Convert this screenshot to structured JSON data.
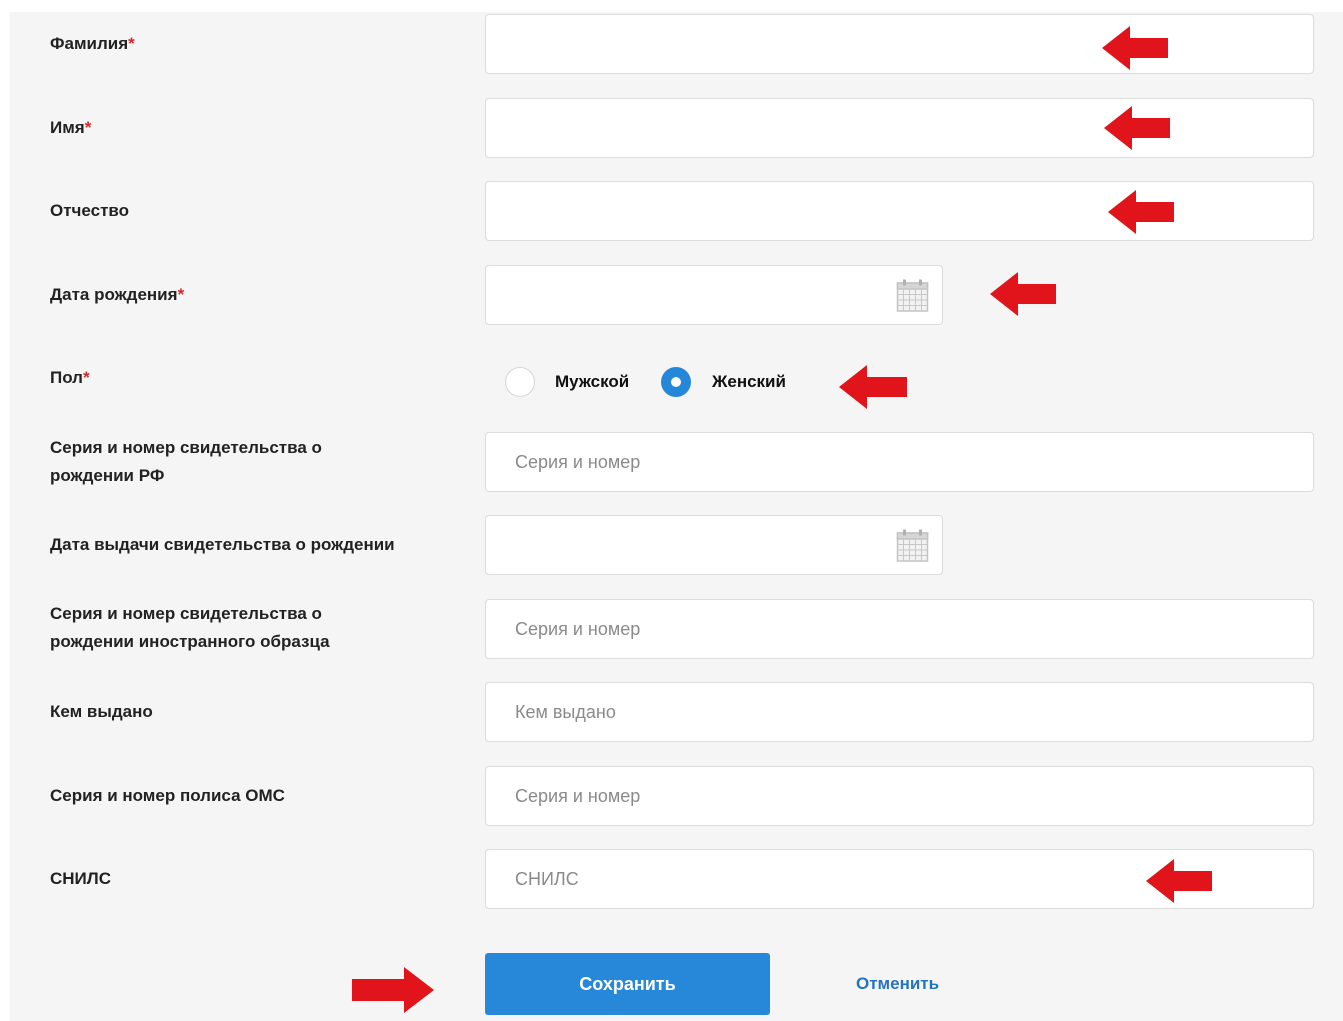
{
  "form": {
    "last_name": {
      "label": "Фамилия",
      "required_mark": "*",
      "value": ""
    },
    "first_name": {
      "label": "Имя",
      "required_mark": "*",
      "value": ""
    },
    "patronymic": {
      "label": "Отчество",
      "value": ""
    },
    "birth_date": {
      "label": "Дата рождения",
      "required_mark": "*",
      "value": "",
      "icon": "calendar-icon"
    },
    "gender": {
      "label": "Пол",
      "required_mark": "*",
      "options": [
        {
          "label": "Мужской",
          "selected": false
        },
        {
          "label": "Женский",
          "selected": true
        }
      ]
    },
    "birth_cert_rf": {
      "label_line1": "Серия и номер свидетельства о",
      "label_line2": "рождении РФ",
      "placeholder": "Серия и номер",
      "value": ""
    },
    "birth_cert_date": {
      "label": "Дата выдачи свидетельства о рождении",
      "value": "",
      "icon": "calendar-icon"
    },
    "birth_cert_foreign": {
      "label_line1": "Серия и номер свидетельства о",
      "label_line2": "рождении иностранного образца",
      "placeholder": "Серия и номер",
      "value": ""
    },
    "issued_by": {
      "label": "Кем выдано",
      "placeholder": "Кем выдано",
      "value": ""
    },
    "oms_policy": {
      "label": "Серия и номер полиса ОМС",
      "placeholder": "Серия и номер",
      "value": ""
    },
    "snils": {
      "label": "СНИЛС",
      "placeholder": "СНИЛС",
      "value": ""
    }
  },
  "actions": {
    "save_label": "Сохранить",
    "cancel_label": "Отменить"
  },
  "colors": {
    "primary_button": "#2788d9",
    "radio_selected": "#2587d8",
    "required_mark": "#d9242a",
    "annotation_arrow": "#e0141a",
    "cancel_link": "#2673bf"
  }
}
